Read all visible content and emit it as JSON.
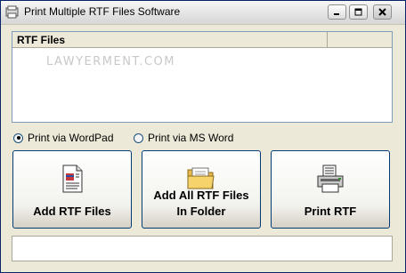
{
  "window": {
    "title": "Print Multiple RTF Files Software",
    "icons": {
      "app": "app-icon",
      "minimize": "minimize-icon",
      "maximize": "maximize-icon",
      "close": "close-icon"
    }
  },
  "file_list": {
    "columns": [
      "RTF Files",
      ""
    ],
    "watermark": "LAWYERMENT.COM"
  },
  "print_options": [
    {
      "label": "Print via WordPad",
      "checked": true
    },
    {
      "label": "Print via MS Word",
      "checked": false
    }
  ],
  "buttons": {
    "add_rtf_files": {
      "line1": "Add RTF Files",
      "icon": "document-icon"
    },
    "add_all_folder": {
      "line1": "Add All RTF Files",
      "line2": "In Folder",
      "icon": "folder-icon"
    },
    "print_rtf": {
      "line1": "Print RTF",
      "icon": "printer-icon"
    }
  },
  "status": {
    "text": ""
  },
  "colors": {
    "accent_border": "#003c74",
    "window_bg": "#ece9d8"
  }
}
